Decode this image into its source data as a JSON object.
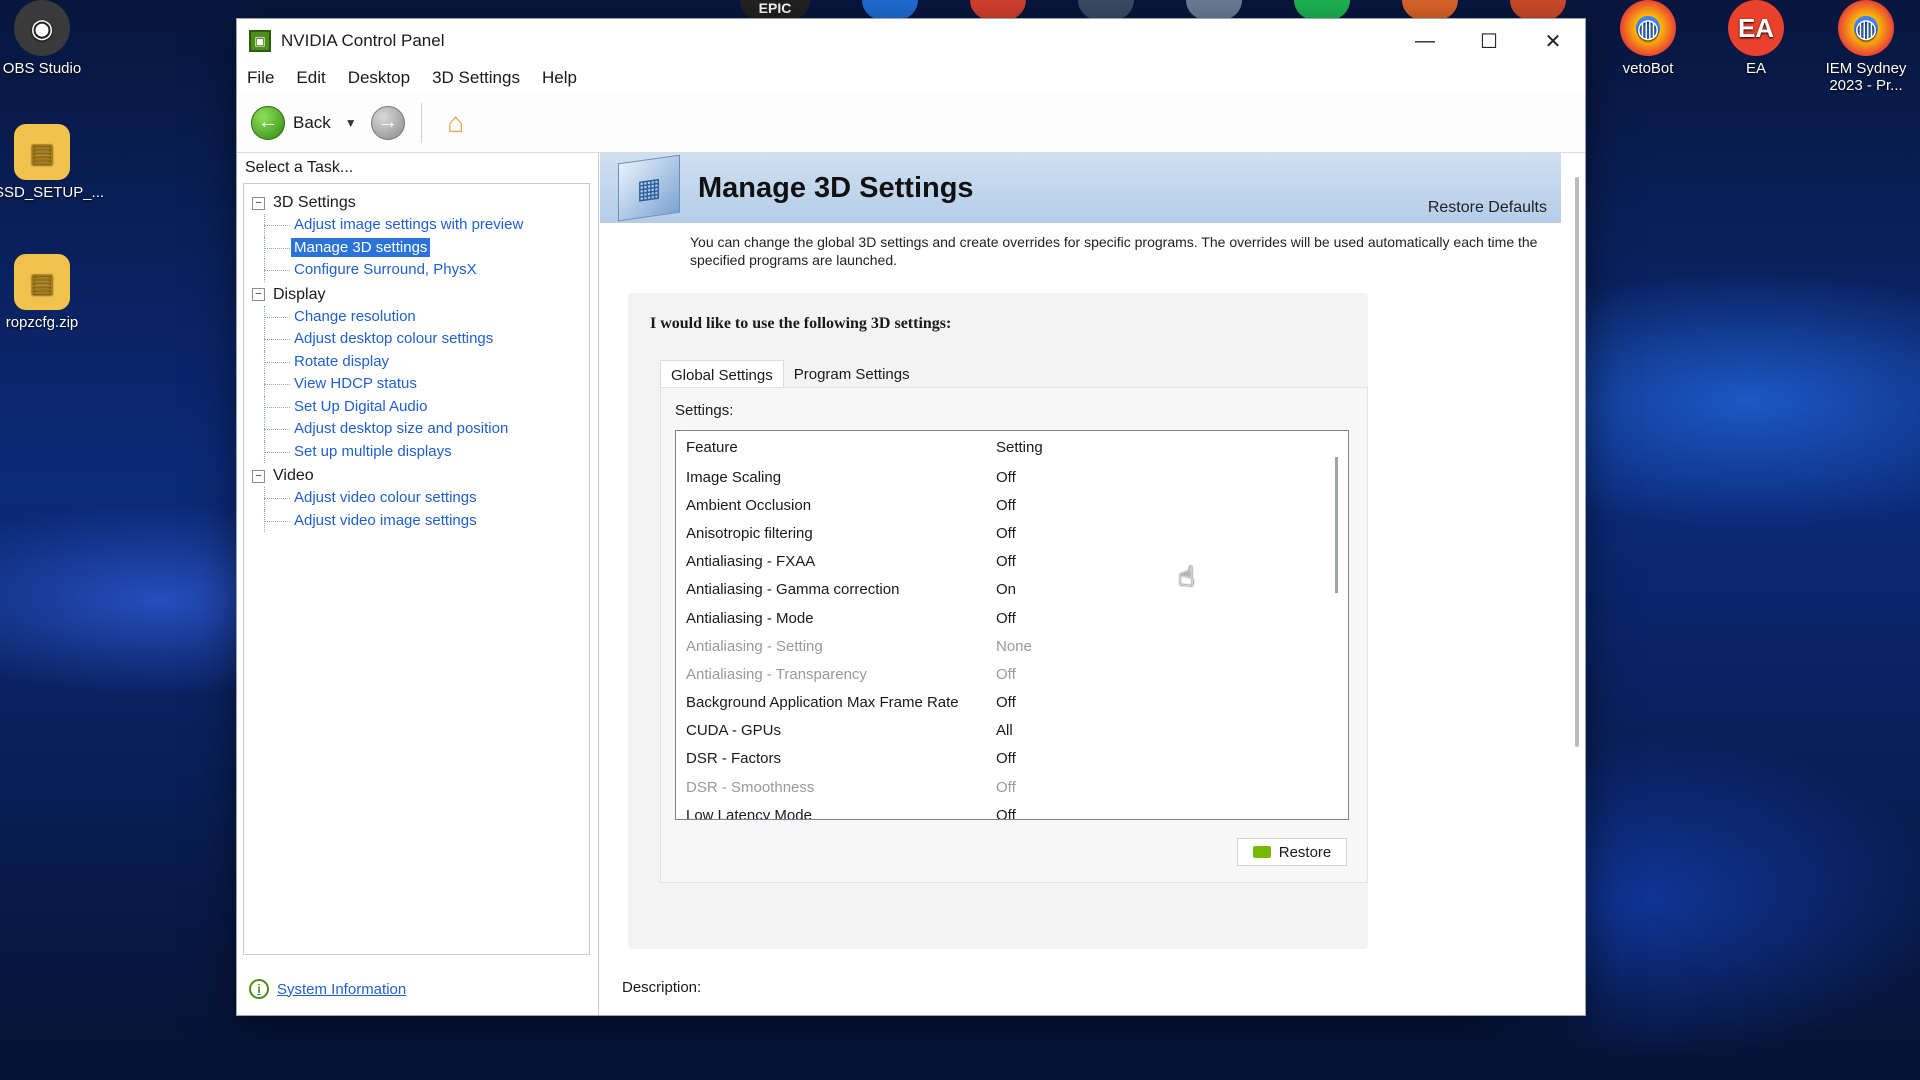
{
  "desktop": {
    "icons": [
      {
        "label": "OBS Studio",
        "glyph": "◉"
      },
      {
        "label": "SSD_SETUP_...",
        "glyph": "▤"
      },
      {
        "label": "ropzcfg.zip",
        "glyph": "▤"
      },
      {
        "label": "vetoBot",
        "glyph": "◍"
      },
      {
        "label": "EA",
        "glyph": "EA"
      },
      {
        "label": "IEM Sydney 2023 - Pr...",
        "glyph": "◍"
      }
    ],
    "top_label": "EPIC"
  },
  "window": {
    "title": "NVIDIA Control Panel",
    "controls": {
      "minimize": "—",
      "maximize": "☐",
      "close": "✕"
    }
  },
  "menu": {
    "items": [
      "File",
      "Edit",
      "Desktop",
      "3D Settings",
      "Help"
    ]
  },
  "toolbar": {
    "back_label": "Back"
  },
  "sidebar": {
    "task_label": "Select a Task...",
    "groups": [
      {
        "label": "3D Settings",
        "items": [
          "Adjust image settings with preview",
          "Manage 3D settings",
          "Configure Surround, PhysX"
        ]
      },
      {
        "label": "Display",
        "items": [
          "Change resolution",
          "Adjust desktop colour settings",
          "Rotate display",
          "View HDCP status",
          "Set Up Digital Audio",
          "Adjust desktop size and position",
          "Set up multiple displays"
        ]
      },
      {
        "label": "Video",
        "items": [
          "Adjust video colour settings",
          "Adjust video image settings"
        ]
      }
    ],
    "selected": "Manage 3D settings",
    "system_info": "System Information"
  },
  "main": {
    "title": "Manage 3D Settings",
    "restore_defaults": "Restore Defaults",
    "description": "You can change the global 3D settings and create overrides for specific programs. The overrides will be used automatically each time the specified programs are launched.",
    "lead": "I would like to use the following 3D settings:",
    "tabs": [
      "Global Settings",
      "Program Settings"
    ],
    "active_tab": "Global Settings",
    "settings_label": "Settings:",
    "columns": [
      "Feature",
      "Setting"
    ],
    "rows": [
      {
        "feature": "Image Scaling",
        "setting": "Off",
        "disabled": false
      },
      {
        "feature": "Ambient Occlusion",
        "setting": "Off",
        "disabled": false
      },
      {
        "feature": "Anisotropic filtering",
        "setting": "Off",
        "disabled": false
      },
      {
        "feature": "Antialiasing - FXAA",
        "setting": "Off",
        "disabled": false
      },
      {
        "feature": "Antialiasing - Gamma correction",
        "setting": "On",
        "disabled": false
      },
      {
        "feature": "Antialiasing - Mode",
        "setting": "Off",
        "disabled": false
      },
      {
        "feature": "Antialiasing - Setting",
        "setting": "None",
        "disabled": true
      },
      {
        "feature": "Antialiasing - Transparency",
        "setting": "Off",
        "disabled": true
      },
      {
        "feature": "Background Application Max Frame Rate",
        "setting": "Off",
        "disabled": false
      },
      {
        "feature": "CUDA - GPUs",
        "setting": "All",
        "disabled": false
      },
      {
        "feature": "DSR - Factors",
        "setting": "Off",
        "disabled": false
      },
      {
        "feature": "DSR - Smoothness",
        "setting": "Off",
        "disabled": true
      },
      {
        "feature": "Low Latency Mode",
        "setting": "Off",
        "disabled": false
      }
    ],
    "restore_button": "Restore",
    "description_label": "Description:"
  },
  "colors": {
    "nvidia_green": "#76b900",
    "selection": "#2c73d8",
    "link": "#1f5fd0"
  }
}
